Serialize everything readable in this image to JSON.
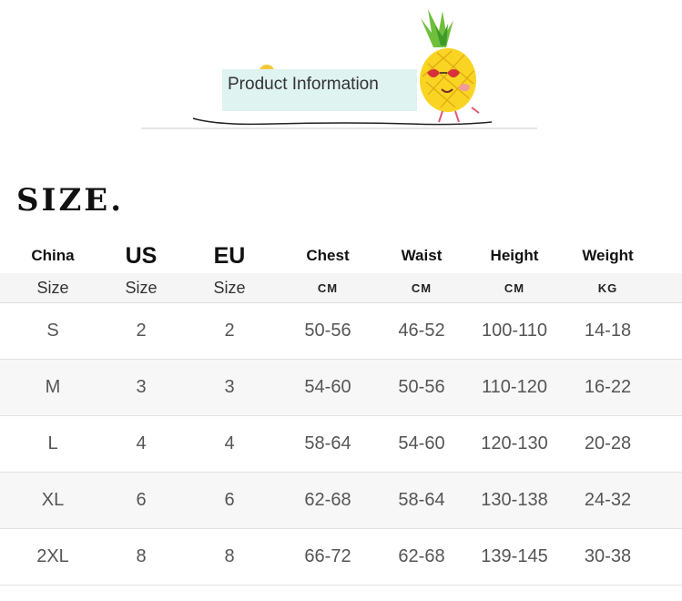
{
  "banner": {
    "label": "Product Information"
  },
  "title": "SIZE",
  "table": {
    "headers": [
      "China",
      "US",
      "EU",
      "Chest",
      "Waist",
      "Height",
      "Weight"
    ],
    "subheaders": [
      "Size",
      "Size",
      "Size",
      "CM",
      "CM",
      "CM",
      "KG"
    ],
    "rows": [
      [
        "S",
        "2",
        "2",
        "50-56",
        "46-52",
        "100-110",
        "14-18"
      ],
      [
        "M",
        "3",
        "3",
        "54-60",
        "50-56",
        "110-120",
        "16-22"
      ],
      [
        "L",
        "4",
        "4",
        "58-64",
        "54-60",
        "120-130",
        "20-28"
      ],
      [
        "XL",
        "6",
        "6",
        "62-68",
        "58-64",
        "130-138",
        "24-32"
      ],
      [
        "2XL",
        "8",
        "8",
        "66-72",
        "62-68",
        "139-145",
        "30-38"
      ]
    ]
  },
  "colors": {
    "banner_label_bg": "#dff3f1",
    "row_alt_bg": "#f7f7f7",
    "pineapple": "#f9d423"
  },
  "icons": [
    "pineapple-mascot-icon",
    "lemon-icon"
  ]
}
